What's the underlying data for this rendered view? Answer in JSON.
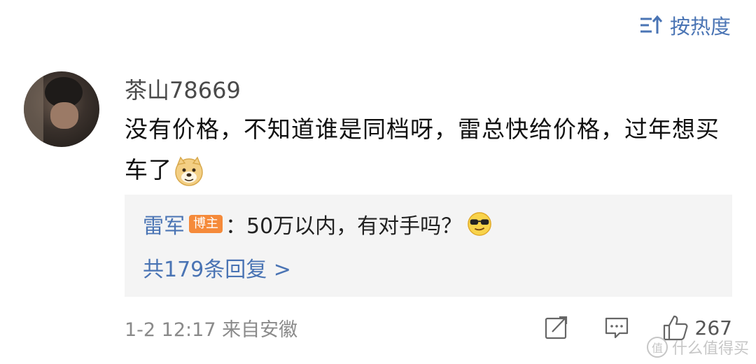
{
  "sort": {
    "label": "按热度",
    "icon": "sort-icon"
  },
  "comment": {
    "username": "茶山78669",
    "text": "没有价格，不知道谁是同档呀，雷总快给价格，过年想买车了",
    "emoji": "doge-emoji",
    "reply": {
      "author": "雷军",
      "badge": "博主",
      "text": "：50万以内，有对手吗？",
      "emoji": "cool-sunglasses-emoji",
      "count_label": "共179条回复 >"
    },
    "timestamp": "1-2 12:17  来自安徽",
    "like_count": "267"
  },
  "watermark": {
    "icon_text": "值",
    "text": "什么值得买"
  },
  "colors": {
    "link": "#4a74b4",
    "badge": "#f58a3a",
    "reply_bg": "#f4f4f4"
  }
}
